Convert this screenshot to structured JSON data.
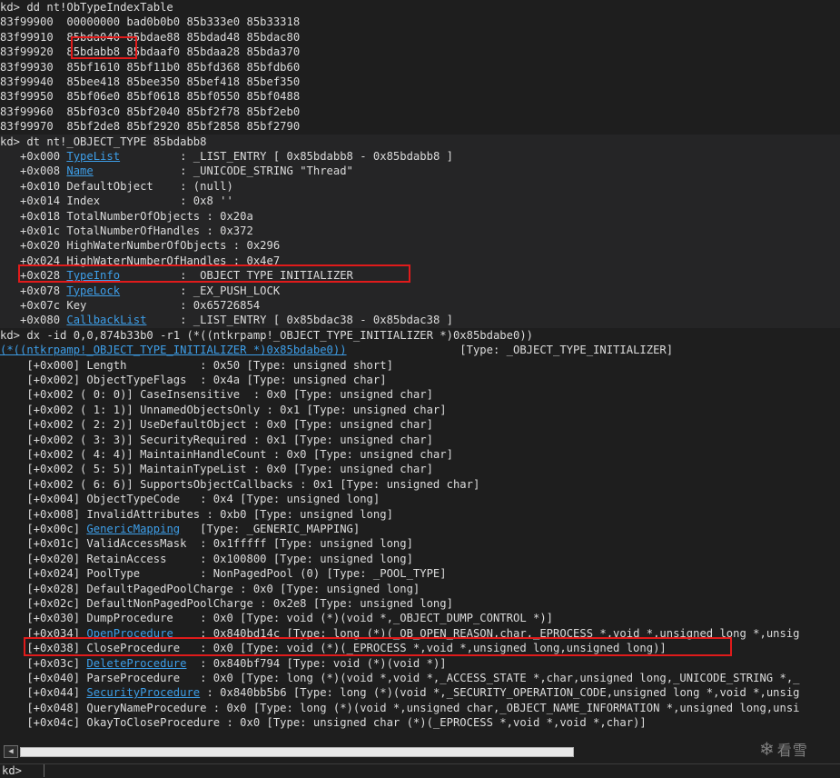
{
  "block1": {
    "lines": [
      "kd> dd nt!ObTypeIndexTable",
      "83f99900  00000000 bad0b0b0 85b333e0 85b33318",
      "83f99910  85bda040 85bdae88 85bdad48 85bdac80",
      "83f99920  85bdabb8 85bdaaf0 85bdaa28 85bda370",
      "83f99930  85bf1610 85bf11b0 85bfd368 85bfdb60",
      "83f99940  85bee418 85bee350 85bef418 85bef350",
      "83f99950  85bf06e0 85bf0618 85bf0550 85bf0488",
      "83f99960  85bf03c0 85bf2040 85bf2f78 85bf2eb0",
      "83f99970  85bf2de8 85bf2920 85bf2858 85bf2790"
    ]
  },
  "block2": {
    "lines": [
      [
        {
          "t": "kd> dt nt!_OBJECT_TYPE 85bdabb8"
        }
      ],
      [
        {
          "t": "   +0x000 "
        },
        {
          "t": "TypeList",
          "link": true
        },
        {
          "t": "         : _LIST_ENTRY [ 0x85bdabb8 - 0x85bdabb8 ]"
        }
      ],
      [
        {
          "t": "   +0x008 "
        },
        {
          "t": "Name",
          "link": true
        },
        {
          "t": "             : _UNICODE_STRING \"Thread\""
        }
      ],
      [
        {
          "t": "   +0x010 DefaultObject    : (null)"
        }
      ],
      [
        {
          "t": "   +0x014 Index            : 0x8 ''"
        }
      ],
      [
        {
          "t": "   +0x018 TotalNumberOfObjects : 0x20a"
        }
      ],
      [
        {
          "t": "   +0x01c TotalNumberOfHandles : 0x372"
        }
      ],
      [
        {
          "t": "   +0x020 HighWaterNumberOfObjects : 0x296"
        }
      ],
      [
        {
          "t": "   +0x024 HighWaterNumberOfHandles : 0x4e7"
        }
      ],
      [
        {
          "t": "   +0x028 "
        },
        {
          "t": "TypeInfo",
          "link": true
        },
        {
          "t": "         : _OBJECT_TYPE_INITIALIZER"
        }
      ],
      [
        {
          "t": "   +0x078 "
        },
        {
          "t": "TypeLock",
          "link": true
        },
        {
          "t": "         : _EX_PUSH_LOCK"
        }
      ],
      [
        {
          "t": "   +0x07c Key              : 0x65726854"
        }
      ],
      [
        {
          "t": "   +0x080 "
        },
        {
          "t": "CallbackList",
          "link": true
        },
        {
          "t": "     : _LIST_ENTRY [ 0x85bdac38 - 0x85bdac38 ]"
        }
      ]
    ]
  },
  "block3": {
    "lines": [
      [
        {
          "t": "kd> dx -id 0,0,874b33b0 -r1 (*((ntkrpamp!_OBJECT_TYPE_INITIALIZER *)0x85bdabe0))"
        }
      ],
      [
        {
          "t": "(*((ntkrpamp!_OBJECT_TYPE_INITIALIZER *)0x85bdabe0))",
          "link": true
        },
        {
          "t": "                 [Type: _OBJECT_TYPE_INITIALIZER]"
        }
      ],
      [
        {
          "t": "    [+0x000] Length           : 0x50 [Type: unsigned short]"
        }
      ],
      [
        {
          "t": "    [+0x002] ObjectTypeFlags  : 0x4a [Type: unsigned char]"
        }
      ],
      [
        {
          "t": "    [+0x002 ( 0: 0)] CaseInsensitive  : 0x0 [Type: unsigned char]"
        }
      ],
      [
        {
          "t": "    [+0x002 ( 1: 1)] UnnamedObjectsOnly : 0x1 [Type: unsigned char]"
        }
      ],
      [
        {
          "t": "    [+0x002 ( 2: 2)] UseDefaultObject : 0x0 [Type: unsigned char]"
        }
      ],
      [
        {
          "t": "    [+0x002 ( 3: 3)] SecurityRequired : 0x1 [Type: unsigned char]"
        }
      ],
      [
        {
          "t": "    [+0x002 ( 4: 4)] MaintainHandleCount : 0x0 [Type: unsigned char]"
        }
      ],
      [
        {
          "t": "    [+0x002 ( 5: 5)] MaintainTypeList : 0x0 [Type: unsigned char]"
        }
      ],
      [
        {
          "t": "    [+0x002 ( 6: 6)] SupportsObjectCallbacks : 0x1 [Type: unsigned char]"
        }
      ],
      [
        {
          "t": "    [+0x004] ObjectTypeCode   : 0x4 [Type: unsigned long]"
        }
      ],
      [
        {
          "t": "    [+0x008] InvalidAttributes : 0xb0 [Type: unsigned long]"
        }
      ],
      [
        {
          "t": "    [+0x00c] "
        },
        {
          "t": "GenericMapping",
          "link": true
        },
        {
          "t": "   [Type: _GENERIC_MAPPING]"
        }
      ],
      [
        {
          "t": "    [+0x01c] ValidAccessMask  : 0x1fffff [Type: unsigned long]"
        }
      ],
      [
        {
          "t": "    [+0x020] RetainAccess     : 0x100800 [Type: unsigned long]"
        }
      ],
      [
        {
          "t": "    [+0x024] PoolType         : NonPagedPool (0) [Type: _POOL_TYPE]"
        }
      ],
      [
        {
          "t": "    [+0x028] DefaultPagedPoolCharge : 0x0 [Type: unsigned long]"
        }
      ],
      [
        {
          "t": "    [+0x02c] DefaultNonPagedPoolCharge : 0x2e8 [Type: unsigned long]"
        }
      ],
      [
        {
          "t": "    [+0x030] DumpProcedure    : 0x0 [Type: void (*)(void *,_OBJECT_DUMP_CONTROL *)]"
        }
      ],
      [
        {
          "t": "    [+0x034] "
        },
        {
          "t": "OpenProcedure",
          "link": true
        },
        {
          "t": "    : 0x840bd14c [Type: long (*)(_OB_OPEN_REASON,char,_EPROCESS *,void *,unsigned long *,unsig"
        }
      ],
      [
        {
          "t": "    [+0x038] CloseProcedure   : 0x0 [Type: void (*)(_EPROCESS *,void *,unsigned long,unsigned long)]"
        }
      ],
      [
        {
          "t": "    [+0x03c] "
        },
        {
          "t": "DeleteProcedure",
          "link": true
        },
        {
          "t": "  : 0x840bf794 [Type: void (*)(void *)]"
        }
      ],
      [
        {
          "t": "    [+0x040] ParseProcedure   : 0x0 [Type: long (*)(void *,void *,_ACCESS_STATE *,char,unsigned long,_UNICODE_STRING *,_"
        }
      ],
      [
        {
          "t": "    [+0x044] "
        },
        {
          "t": "SecurityProcedure",
          "link": true
        },
        {
          "t": " : 0x840bb5b6 [Type: long (*)(void *,_SECURITY_OPERATION_CODE,unsigned long *,void *,unsig"
        }
      ],
      [
        {
          "t": "    [+0x048] QueryNameProcedure : 0x0 [Type: long (*)(void *,unsigned char,_OBJECT_NAME_INFORMATION *,unsigned long,unsi"
        }
      ],
      [
        {
          "t": "    [+0x04c] OkayToCloseProcedure : 0x0 [Type: unsigned char (*)(_EPROCESS *,void *,void *,char)]"
        }
      ]
    ]
  },
  "scrollbar": {
    "left_arrow": "◀"
  },
  "watermark": {
    "icon": "snowflake-icon",
    "glyph": "❄",
    "text": "看雪"
  },
  "command": {
    "prompt": "kd>",
    "value": ""
  },
  "colors": {
    "background": "#1e1e1e",
    "text": "#dcdcdc",
    "link": "#3d9ee8",
    "highlight": "#e01b1b"
  }
}
